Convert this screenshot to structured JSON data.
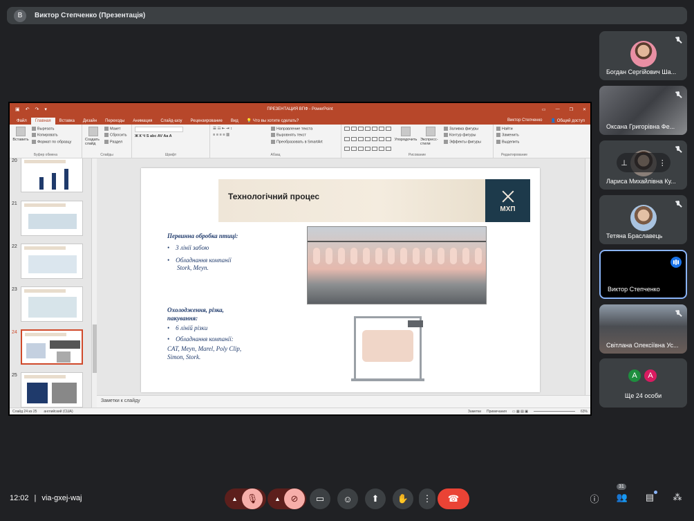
{
  "presenter_bar": {
    "avatar": "В",
    "title": "Виктор Степченко (Презентація)"
  },
  "powerpoint": {
    "doc_title": "ПРЕЗЕНТАЦИЯ ВПФ - PowerPoint",
    "user": "Виктор Степченко",
    "share": "Общий доступ",
    "tabs": [
      "Файл",
      "Главная",
      "Вставка",
      "Дизайн",
      "Переходы",
      "Анимация",
      "Слайд-шоу",
      "Рецензирование",
      "Вид"
    ],
    "active_tab": "Главная",
    "tell_me": "Что вы хотите сделать?",
    "ribbon": {
      "clipboard": {
        "paste": "Вставить",
        "cut": "Вырезать",
        "copy": "Копировать",
        "format": "Формат по образцу",
        "name": "Буфер обмена"
      },
      "slides": {
        "create": "Создать слайд",
        "layout": "Макет",
        "reset": "Сбросить",
        "section": "Раздел",
        "name": "Слайды"
      },
      "font": {
        "name": "Шрифт"
      },
      "paragraph": {
        "dir": "Направление текста",
        "align": "Выровнять текст",
        "smartart": "Преобразовать в SmartArt",
        "name": "Абзац"
      },
      "drawing": {
        "arrange": "Упорядочить",
        "quick": "Экспресс-стили",
        "fill": "Заливка фигуры",
        "outline": "Контур фигуры",
        "effects": "Эффекты фигуры",
        "name": "Рисование"
      },
      "editing": {
        "find": "Найти",
        "replace": "Заменить",
        "select": "Выделить",
        "name": "Редактирование"
      }
    },
    "thumbnails": [
      "20",
      "21",
      "22",
      "23",
      "24",
      "25"
    ],
    "selected_slide": "24",
    "slide": {
      "title": "Технологічний процес",
      "logo": "МХП",
      "heading1": "Первинна обробка птиці:",
      "item1": "3 лінії забою",
      "item2_a": "Обладнання компанії",
      "item2_b": "Stork, Meyn.",
      "heading2_a": "Охолодження, різка,",
      "heading2_b": "пакування:",
      "item3": "6 ліній різки",
      "item4": "Обладнання компанії:",
      "item5_a": "CAT, Meyn, Marel, Poly Clip,",
      "item5_b": "Simon, Stork."
    },
    "notes": "Заметки к слайду",
    "status": {
      "slide_of": "Слайд 24 из 25",
      "lang": "английский (США)",
      "notes": "Заметки",
      "comments": "Примечания",
      "zoom": "63%"
    }
  },
  "participants": [
    {
      "name": "Богдан Сергійович Ша...",
      "muted": true
    },
    {
      "name": "Оксана Григорівна Фе...",
      "muted": true
    },
    {
      "name": "Лариса Михайлівна Ку...",
      "muted": true
    },
    {
      "name": "Тетяна Браславець",
      "muted": true
    },
    {
      "name": "Виктор Степченко",
      "muted": false
    },
    {
      "name": "Світлана Олексіївна Ус...",
      "muted": true
    }
  ],
  "more_participants": {
    "label": "Ще 24 особи",
    "avatars": [
      "A",
      "A"
    ],
    "colors": [
      "#1e8e3e",
      "#d81b60"
    ]
  },
  "bottom_bar": {
    "time": "12:02",
    "separator": "|",
    "meeting_code": "via-gxej-waj",
    "people_count": "31"
  },
  "colors": {
    "ppt_accent": "#b7472a",
    "end_call": "#ea4335",
    "bg": "#202124"
  }
}
